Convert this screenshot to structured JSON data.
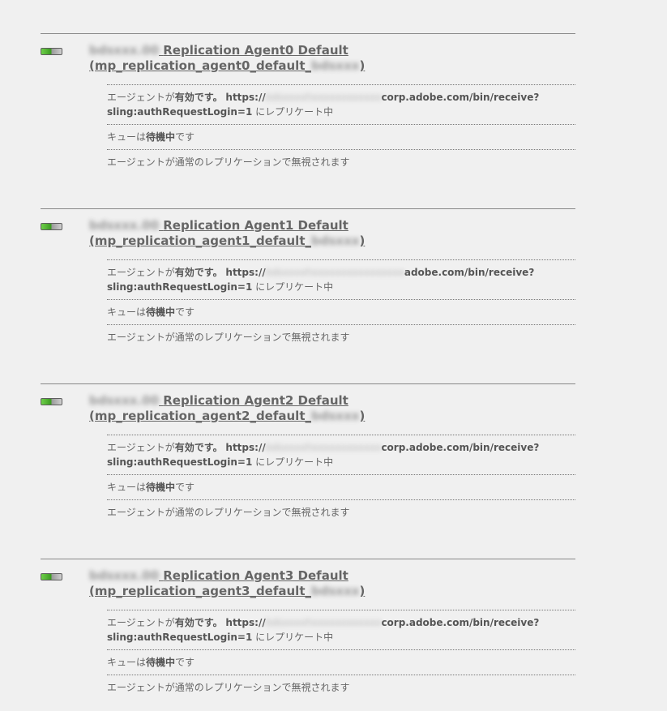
{
  "agents": [
    {
      "redacted_prefix": "bdsxxx.00",
      "title": "Replication Agent0 Default",
      "id_prefix": "(mp_replication_agent0_default_",
      "id_redacted": "bdsxxx",
      "id_suffix": ")",
      "status_prefix": "エージェントが",
      "status_bold": "有効です。",
      "url_prefix": "https://",
      "url_redacted": "bdsxxxxhxxxxxxxxxxxx",
      "url_suffix": "corp.adobe.com/bin/receive?",
      "url_line2": "sling:authRequestLogin=1",
      "replicate_text": " にレプリケート中",
      "queue_prefix": "キューは",
      "queue_bold": "待機中",
      "queue_suffix": "です",
      "ignore_text": "エージェントが通常のレプリケーションで無視されます"
    },
    {
      "redacted_prefix": "bdsxxx.00",
      "title": "Replication Agent1 Default",
      "id_prefix": "(mp_replication_agent1_default_",
      "id_redacted": "bdsxxx",
      "id_suffix": ")",
      "status_prefix": "エージェントが",
      "status_bold": "有効です。",
      "url_prefix": "https://",
      "url_redacted": "bdsxxxxhxxxxxxxxxxxxxxxx",
      "url_suffix": "adobe.com/bin/receive?",
      "url_line2": "sling:authRequestLogin=1",
      "replicate_text": " にレプリケート中",
      "queue_prefix": "キューは",
      "queue_bold": "待機中",
      "queue_suffix": "です",
      "ignore_text": "エージェントが通常のレプリケーションで無視されます"
    },
    {
      "redacted_prefix": "bdsxxx.00",
      "title": "Replication Agent2 Default",
      "id_prefix": "(mp_replication_agent2_default_",
      "id_redacted": "bdsxxx",
      "id_suffix": ")",
      "status_prefix": "エージェントが",
      "status_bold": "有効です。",
      "url_prefix": "https://",
      "url_redacted": "bdsxxxxhxxxxxxxxxxxx",
      "url_suffix": "corp.adobe.com/bin/receive?",
      "url_line2": "sling:authRequestLogin=1",
      "replicate_text": " にレプリケート中",
      "queue_prefix": "キューは",
      "queue_bold": "待機中",
      "queue_suffix": "です",
      "ignore_text": "エージェントが通常のレプリケーションで無視されます"
    },
    {
      "redacted_prefix": "bdsxxx.00",
      "title": "Replication Agent3 Default",
      "id_prefix": "(mp_replication_agent3_default_",
      "id_redacted": "bdsxxx",
      "id_suffix": ")",
      "status_prefix": "エージェントが",
      "status_bold": "有効です。",
      "url_prefix": "https://",
      "url_redacted": "bdsxxxxhxxxxxxxxxxxx",
      "url_suffix": "corp.adobe.com/bin/receive?",
      "url_line2": "sling:authRequestLogin=1",
      "replicate_text": " にレプリケート中",
      "queue_prefix": "キューは",
      "queue_bold": "待機中",
      "queue_suffix": "です",
      "ignore_text": "エージェントが通常のレプリケーションで無視されます"
    }
  ]
}
